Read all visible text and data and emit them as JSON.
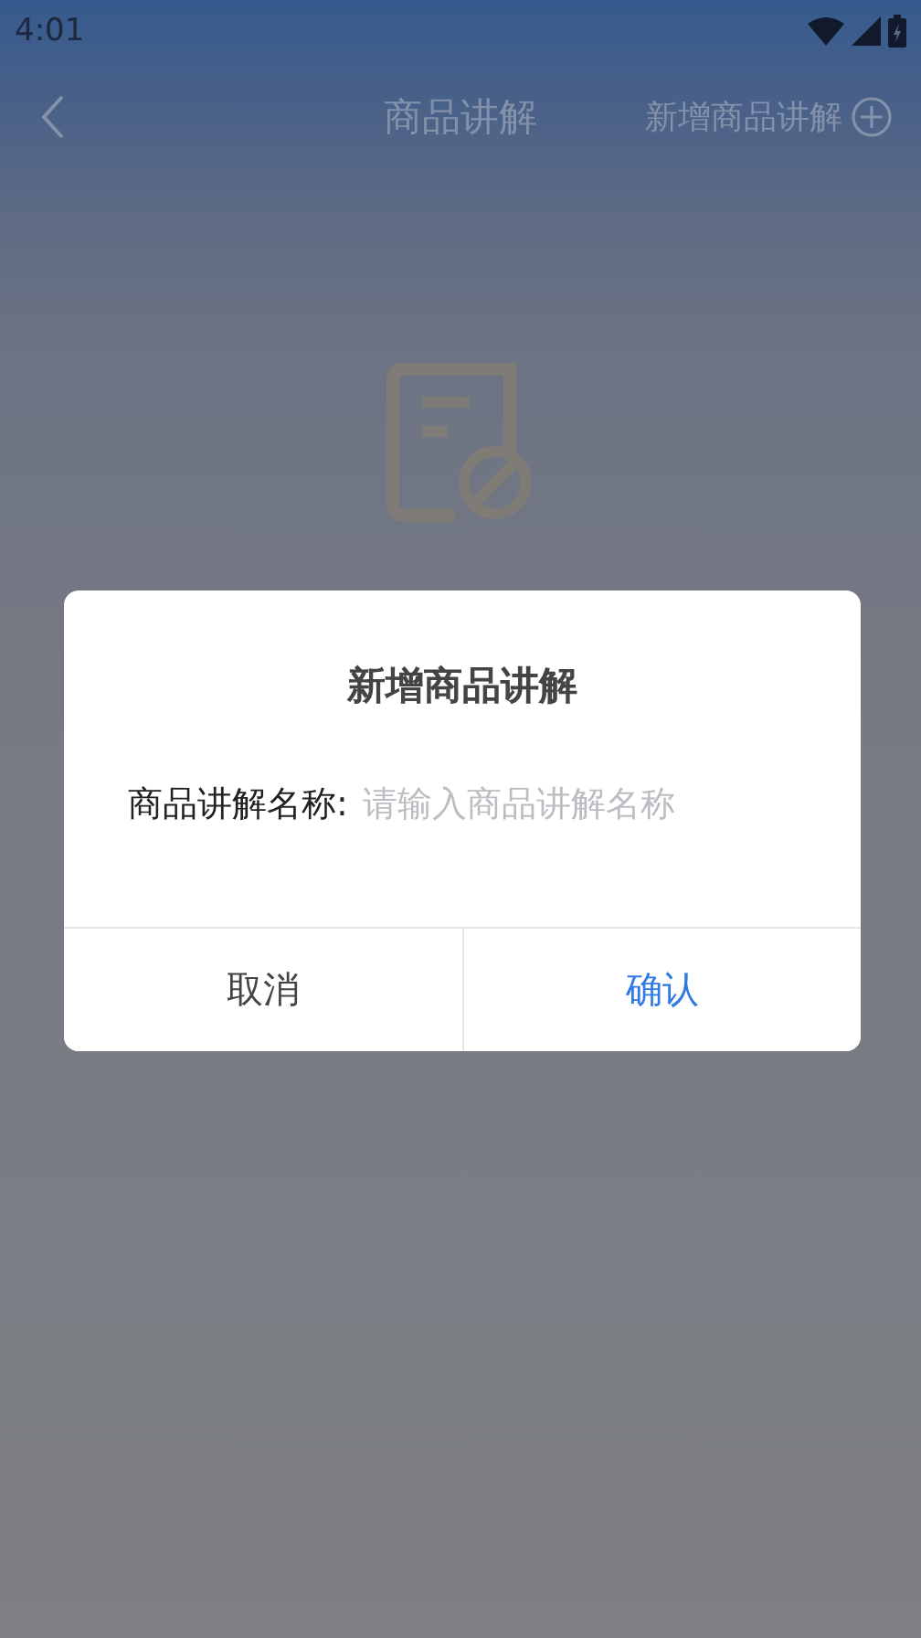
{
  "status_bar": {
    "time": "4:01"
  },
  "header": {
    "title": "商品讲解",
    "action": "新增商品讲解"
  },
  "dialog": {
    "title": "新增商品讲解",
    "field": {
      "label": "商品讲解名称:",
      "placeholder": "请输入商品讲解名称"
    },
    "buttons": [
      {
        "label": "取消",
        "kind": "cancel"
      },
      {
        "label": "确认",
        "kind": "confirm"
      }
    ]
  }
}
